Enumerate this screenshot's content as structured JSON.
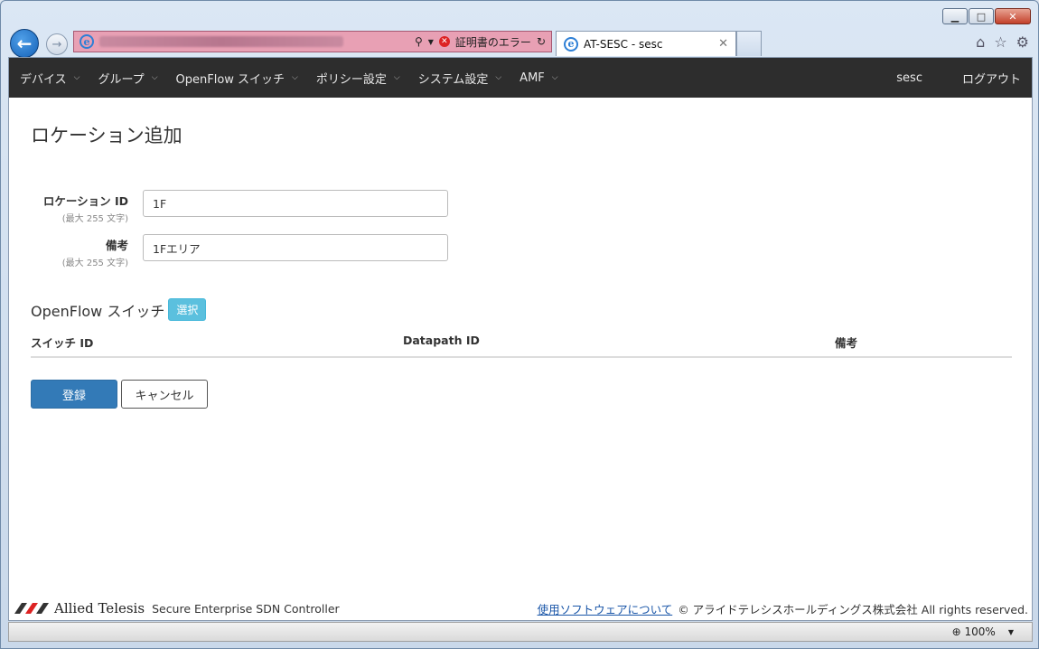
{
  "browser": {
    "address_status": "証明書のエラー",
    "tab_title": "AT-SESC - sesc",
    "zoom": "100%"
  },
  "navbar": {
    "items": [
      {
        "label": "デバイス"
      },
      {
        "label": "グループ"
      },
      {
        "label": "OpenFlow スイッチ"
      },
      {
        "label": "ポリシー設定"
      },
      {
        "label": "システム設定"
      },
      {
        "label": "AMF"
      }
    ],
    "user": "sesc",
    "logout": "ログアウト"
  },
  "page": {
    "title": "ロケーション追加"
  },
  "form": {
    "location_id": {
      "label": "ロケーション ID",
      "hint": "(最大 255 文字)",
      "value": "1F"
    },
    "remarks": {
      "label": "備考",
      "hint": "(最大 255 文字)",
      "value": "1Fエリア"
    }
  },
  "switches": {
    "title": "OpenFlow スイッチ",
    "select_label": "選択",
    "columns": [
      "スイッチ ID",
      "Datapath ID",
      "備考"
    ]
  },
  "actions": {
    "submit": "登録",
    "cancel": "キャンセル"
  },
  "footer": {
    "brand": "Allied Telesis",
    "product": "Secure Enterprise SDN Controller",
    "about_link": "使用ソフトウェアについて",
    "copyright": "© アライドテレシスホールディングス株式会社 All rights reserved."
  }
}
